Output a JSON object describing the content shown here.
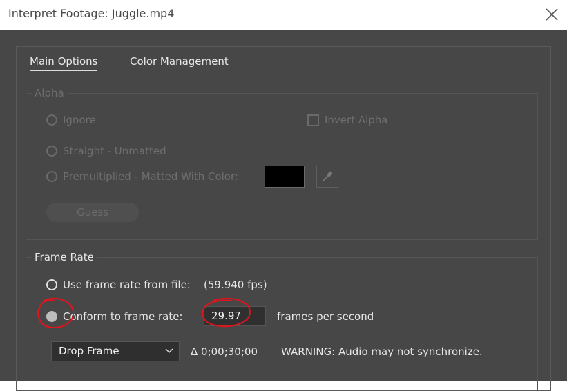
{
  "window": {
    "title": "Interpret Footage: Juggle.mp4",
    "close_icon": "close-icon"
  },
  "tabs": [
    {
      "label": "Main Options",
      "active": true
    },
    {
      "label": "Color Management",
      "active": false
    }
  ],
  "alpha": {
    "legend": "Alpha",
    "ignore": "Ignore",
    "invert": "Invert Alpha",
    "straight": "Straight - Unmatted",
    "premultiplied": "Premultiplied - Matted With Color:",
    "matte_color": "#000000",
    "guess_label": "Guess"
  },
  "frame_rate": {
    "legend": "Frame Rate",
    "use_file_label": "Use frame rate from file:",
    "file_fps": "(59.940 fps)",
    "conform_label": "Conform to frame rate:",
    "conform_value": "29.97",
    "fps_unit": "frames per second",
    "dropdown_value": "Drop Frame",
    "duration": "Δ 0;00;30;00",
    "warning": "WARNING: Audio may not synchronize."
  },
  "colors": {
    "background": "#474747",
    "annotation": "#e0141c"
  }
}
